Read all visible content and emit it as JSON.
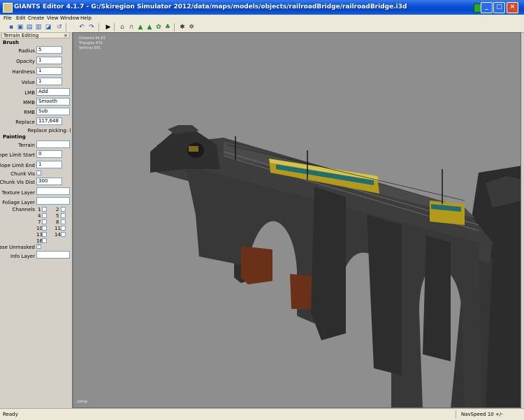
{
  "window": {
    "title": "GIANTS Editor 4.1.7 - G:/Skiregion Simulator 2012/data/maps/models/objects/railroadBridge/railroadBridge.i3d"
  },
  "menu": [
    "File",
    "Edit",
    "Create",
    "View",
    "Window",
    "Help"
  ],
  "toolbar_icons": [
    "new-icon",
    "open-icon",
    "save-icon",
    "save-as-icon",
    "import-icon",
    "rotate-icon",
    "undo-icon",
    "redo-icon",
    "play-icon",
    "home-icon",
    "transform-icon",
    "terrain-icon",
    "paint-icon",
    "foliage-icon",
    "tree-icon",
    "gear-icon",
    "settings-icon"
  ],
  "panel": {
    "header": "Terrain Editing",
    "brush_title": "Brush",
    "radius_label": "Radius",
    "radius_value": "5",
    "opacity_label": "Opacity",
    "opacity_value": "1",
    "hardness_label": "Hardness",
    "hardness_value": "1",
    "value_label": "Value",
    "value_value": "1",
    "lmb_label": "LMB",
    "lmb_value": "Add",
    "mmb_label": "MMB",
    "mmb_value": "Smooth",
    "rmb_label": "RMB",
    "rmb_value": "Sub",
    "replace_label": "Replace",
    "replace_value": "117,648",
    "replace_picking_label": "Replace picking: (",
    "painting_title": "Painting",
    "terrain_label": "Terrain",
    "terrain_value": "",
    "slope_start_label": "Slope Limit Start",
    "slope_start_value": "0",
    "slope_end_label": "Slope Limit End",
    "slope_end_value": "1",
    "chunk_vis_label": "Chunk Vis",
    "chunk_vis_dist_label": "Chunk Vis Dist",
    "chunk_vis_dist_value": "300",
    "texture_layer_label": "Texture Layer",
    "texture_layer_value": "",
    "foliage_layer_label": "Foliage Layer",
    "foliage_layer_value": "",
    "channels_label": "Channels",
    "channels": [
      "1",
      "2",
      "4",
      "5",
      "7",
      "8",
      "10",
      "11",
      "13",
      "14",
      "16"
    ],
    "erase_unmasked_label": "Erase Unmasked",
    "info_layer_label": "Info Layer",
    "info_layer_value": ""
  },
  "viewport": {
    "stats": [
      "Distance 64.82",
      "Triangles 470",
      "Vertices 691"
    ],
    "camera_name": "persp"
  },
  "status": {
    "text": "Ready",
    "navspeed": "NavSpeed 10 +/-"
  }
}
